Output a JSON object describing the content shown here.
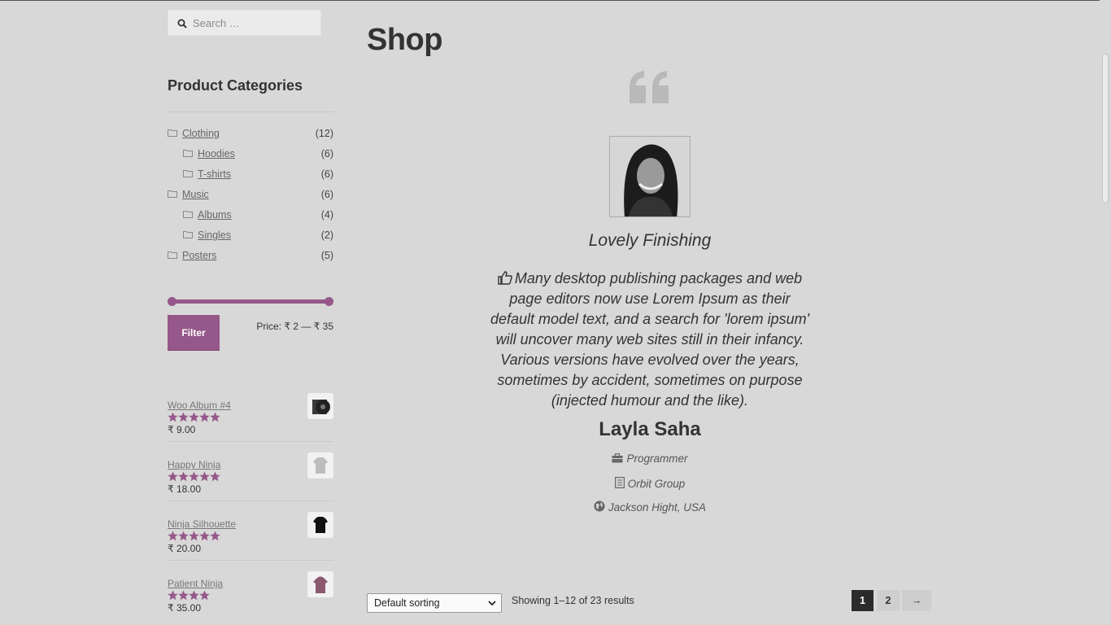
{
  "search": {
    "placeholder": "Search …"
  },
  "categories_widget": {
    "title": "Product Categories",
    "items": [
      {
        "label": "Clothing",
        "count": "(12)"
      },
      {
        "label": "Hoodies",
        "count": "(6)"
      },
      {
        "label": "T-shirts",
        "count": "(6)"
      },
      {
        "label": "Music",
        "count": "(6)"
      },
      {
        "label": "Albums",
        "count": "(4)"
      },
      {
        "label": "Singles",
        "count": "(2)"
      },
      {
        "label": "Posters",
        "count": "(5)"
      }
    ]
  },
  "price_filter": {
    "button_label": "Filter",
    "price_text": "Price: ₹ 2 — ₹ 35",
    "accent_color": "#96588a"
  },
  "products": [
    {
      "name": "Woo Album #4",
      "rating": 5,
      "price": "₹ 9.00"
    },
    {
      "name": "Happy Ninja",
      "rating": 5,
      "price": "₹ 18.00"
    },
    {
      "name": "Ninja Silhouette",
      "rating": 5,
      "price": "₹ 20.00"
    },
    {
      "name": "Patient Ninja",
      "rating": 4.7,
      "price": "₹ 35.00"
    }
  ],
  "main": {
    "page_title": "Shop",
    "testimonial": {
      "title": "Lovely Finishing",
      "text": "Many desktop publishing packages and web page editors now use Lorem Ipsum as their default model text, and a search for 'lorem ipsum' will uncover many web sites still in their infancy. Various versions have evolved over the years, sometimes by accident, sometimes on purpose (injected humour and the like).",
      "name": "Layla Saha",
      "role": "Programmer",
      "company": "Orbit Group",
      "location": "Jackson Hight, USA"
    }
  },
  "toolbar": {
    "sort_value": "Default sorting",
    "result_count": "Showing 1–12 of 23 results"
  },
  "pagination": {
    "pages": [
      "1",
      "2"
    ],
    "current": "1",
    "next": "→"
  }
}
